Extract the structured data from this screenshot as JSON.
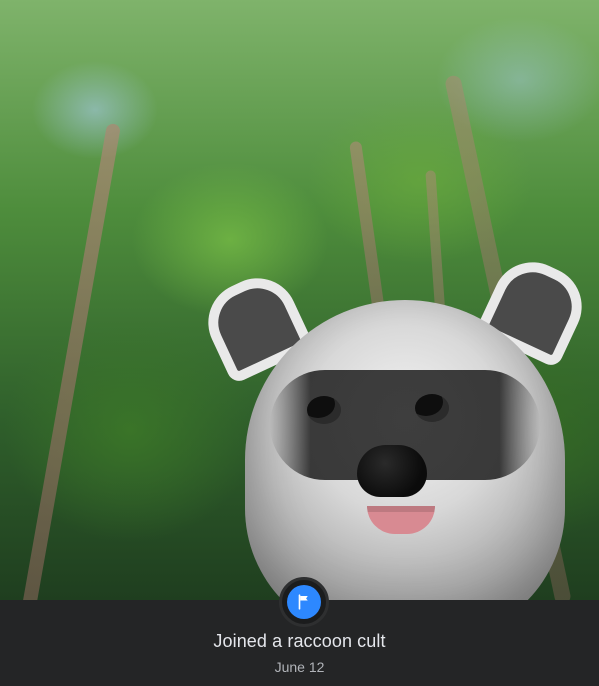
{
  "life_event": {
    "title": "Joined a raccoon cult",
    "date": "June 12",
    "badge_icon": "flag-icon",
    "badge_color": "#2d88ff"
  },
  "theme": {
    "background": "#242526",
    "title_color": "#e4e6eb",
    "date_color": "#b0b3b8"
  }
}
